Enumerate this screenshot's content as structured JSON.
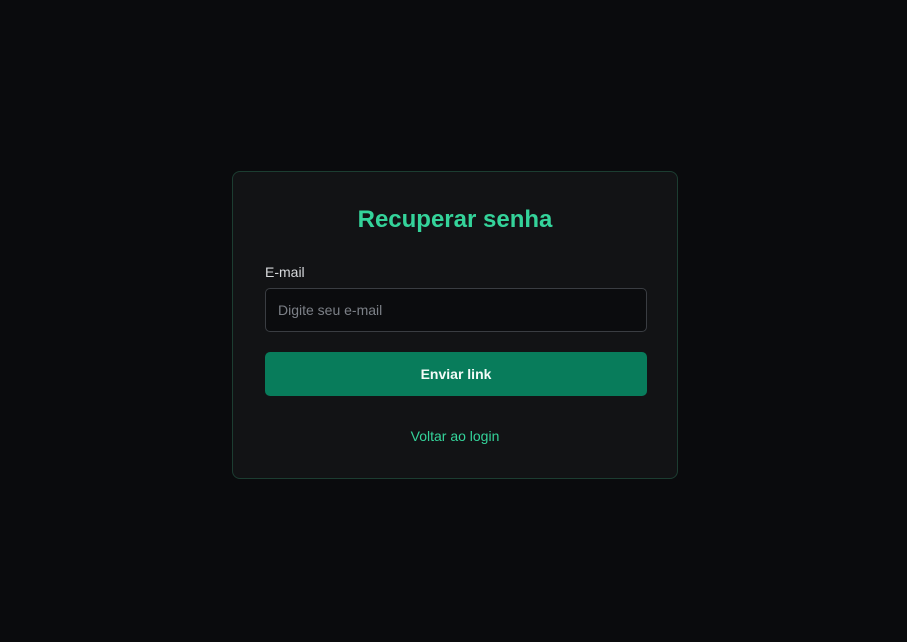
{
  "form": {
    "title": "Recuperar senha",
    "email_label": "E-mail",
    "email_value": "",
    "email_placeholder": "Digite seu e-mail",
    "submit_label": "Enviar link",
    "back_link_label": "Voltar ao login"
  },
  "colors": {
    "background": "#0a0b0d",
    "card_background": "#121315",
    "card_border": "#1c3d31",
    "accent": "#34d39a",
    "button": "#087c5b"
  }
}
